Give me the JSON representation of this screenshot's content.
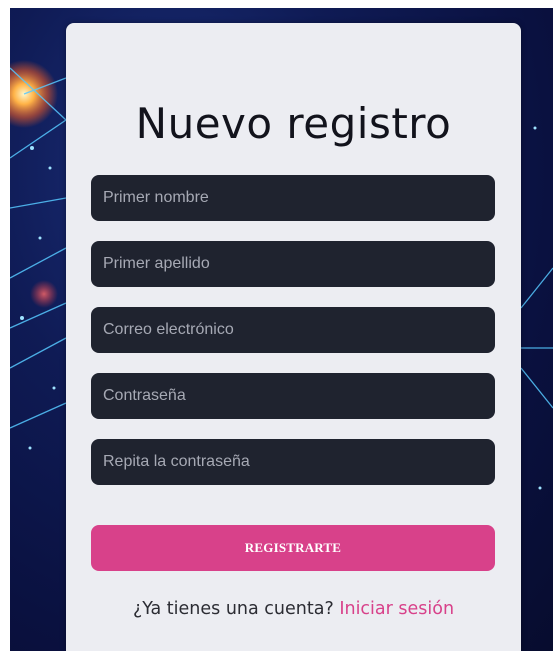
{
  "form": {
    "title": "Nuevo registro",
    "fields": [
      {
        "placeholder": "Primer nombre",
        "value": ""
      },
      {
        "placeholder": "Primer apellido",
        "value": ""
      },
      {
        "placeholder": "Correo electrónico",
        "value": ""
      },
      {
        "placeholder": "Contraseña",
        "value": ""
      },
      {
        "placeholder": "Repita la contraseña",
        "value": ""
      }
    ],
    "submit_label": "REGISTRARTE",
    "footer_text": "¿Ya tienes una cuenta? ",
    "login_link": "Iniciar sesión"
  },
  "colors": {
    "accent": "#d8418a",
    "field_bg": "#1f232f",
    "card_bg": "#ecedf2",
    "background": "#0f1b55"
  }
}
